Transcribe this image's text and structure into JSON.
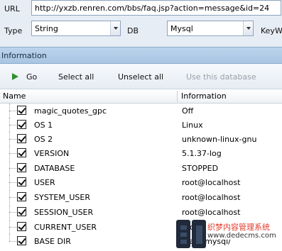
{
  "form": {
    "url_label": "URL",
    "url_value": "http://yxzb.renren.com/bbs/faq.jsp?action=message&id=24",
    "type_label": "Type",
    "type_value": "String",
    "db_label": "DB",
    "db_value": "Mysql",
    "keyword_label": "KeyW"
  },
  "panel": {
    "title": "Information"
  },
  "toolbar": {
    "go": "Go",
    "select_all": "Select all",
    "unselect_all": "Unselect all",
    "use_db": "Use this database"
  },
  "columns": {
    "name": "Name",
    "info": "Information"
  },
  "rows": [
    {
      "name": "magic_quotes_gpc",
      "value": "Off"
    },
    {
      "name": "OS 1",
      "value": "Linux"
    },
    {
      "name": "OS 2",
      "value": "unknown-linux-gnu"
    },
    {
      "name": "VERSION",
      "value": "5.1.37-log"
    },
    {
      "name": "DATABASE",
      "value": "STOPPED"
    },
    {
      "name": "USER",
      "value": "root@localhost"
    },
    {
      "name": "SYSTEM_USER",
      "value": "root@localhost"
    },
    {
      "name": "SESSION_USER",
      "value": "root@localhost"
    },
    {
      "name": "CURRENT_USER",
      "value": "root"
    },
    {
      "name": "BASE DIR",
      "value": "/data/mysql/"
    }
  ],
  "watermark": {
    "line1": "织梦内容管理系统",
    "line2": "www.dedecms.com"
  },
  "colors": {
    "go_icon": "#2f8f2f",
    "header": "#a9c5e3",
    "watermark_red": "#e23a2a"
  }
}
